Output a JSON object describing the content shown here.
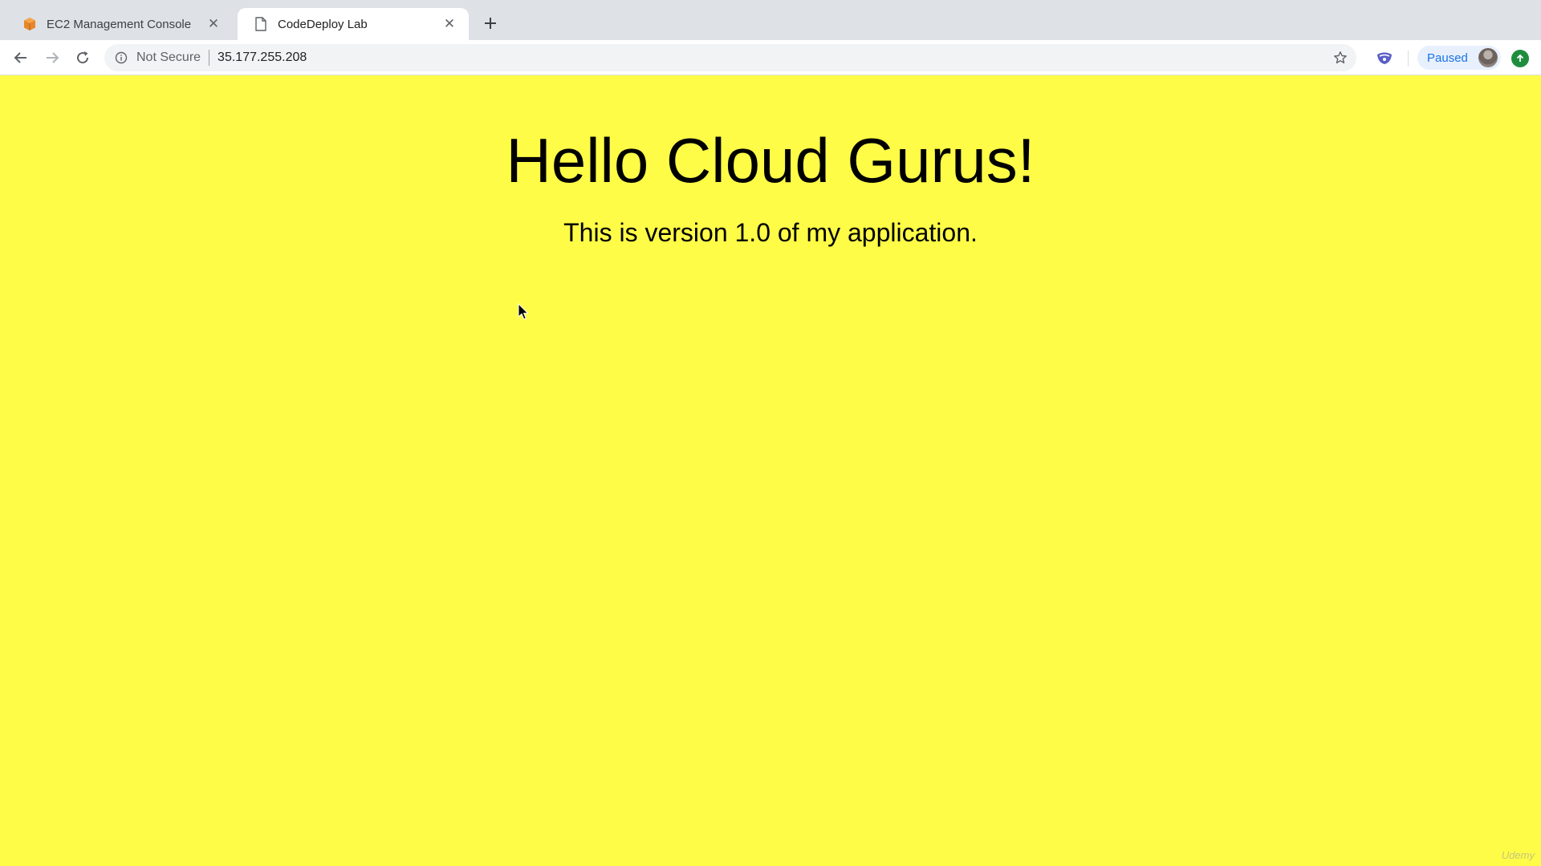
{
  "browser": {
    "tabs": [
      {
        "title": "EC2 Management Console",
        "favicon": "aws-box-icon",
        "active": false
      },
      {
        "title": "CodeDeploy Lab",
        "favicon": "document-icon",
        "active": true
      }
    ],
    "address_bar": {
      "security_label": "Not Secure",
      "url": "35.177.255.208"
    },
    "profile": {
      "status": "Paused"
    }
  },
  "page": {
    "background_color": "#fefc47",
    "heading": "Hello Cloud Gurus!",
    "subheading": "This is version 1.0 of my application."
  },
  "watermark": "Udemy"
}
